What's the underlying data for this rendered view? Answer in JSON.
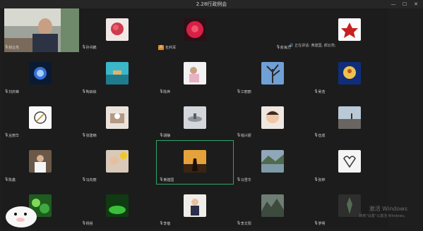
{
  "window": {
    "title": "2.28行政例会",
    "controls": {
      "minimize": "—",
      "maximize": "☐",
      "close": "✕"
    }
  },
  "speaking": {
    "text": "正在讲话: 黄建国, 郝云亮;"
  },
  "participants": [
    {
      "name": "郝云亮",
      "mic": true
    },
    {
      "name": "孙书鹏",
      "mic": true
    },
    {
      "name": "杜利军",
      "mic": false
    },
    {
      "name": "俞海力",
      "mic": true
    },
    {
      "name": "",
      "mic": false
    },
    {
      "name": "刘庆峰",
      "mic": true
    },
    {
      "name": "陶启栋",
      "mic": true
    },
    {
      "name": "陈烨",
      "mic": true
    },
    {
      "name": "江丽丽",
      "mic": true
    },
    {
      "name": "吴浩",
      "mic": true
    },
    {
      "name": "丛丽华",
      "mic": true
    },
    {
      "name": "张建楠",
      "mic": true
    },
    {
      "name": "胡静",
      "mic": true
    },
    {
      "name": "钱兴振",
      "mic": true
    },
    {
      "name": "伍成",
      "mic": true
    },
    {
      "name": "陈鑫",
      "mic": true
    },
    {
      "name": "冯向丽",
      "mic": true
    },
    {
      "name": "黄建国",
      "mic": true
    },
    {
      "name": "马雪华",
      "mic": true
    },
    {
      "name": "张婷",
      "mic": true
    },
    {
      "name": "",
      "mic": false
    },
    {
      "name": "杨晃",
      "mic": true
    },
    {
      "name": "李蓓",
      "mic": true
    },
    {
      "name": "李文阳",
      "mic": true
    },
    {
      "name": "罗明",
      "mic": true
    }
  ],
  "watermark": {
    "line1": "激活 Windows",
    "line2": "转到\"设置\"以激活 Windows。"
  },
  "colors": {
    "active_border": "#2fa56a",
    "background": "#1e1e1e"
  }
}
